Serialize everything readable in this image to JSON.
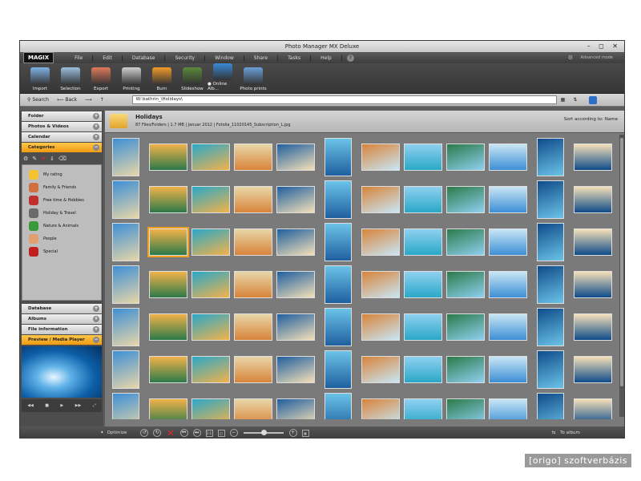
{
  "window": {
    "title": "Photo Manager MX Deluxe",
    "controls": "– ◻ ✕"
  },
  "menu": {
    "logo": "MAGIX",
    "items": [
      "File",
      "Edit",
      "Database",
      "Security",
      "Window",
      "Share",
      "Tasks",
      "Help"
    ],
    "advanced_mode": "Advanced mode"
  },
  "toolbar": {
    "buttons": [
      {
        "label": "Import",
        "color": "#7fb3e6"
      },
      {
        "label": "Selection",
        "color": "#9ac0e0"
      },
      {
        "label": "Export",
        "color": "#e07a5a"
      },
      {
        "label": "Printing",
        "color": "#cfcfcf"
      },
      {
        "label": "Burn",
        "color": "#f39a2a"
      },
      {
        "label": "Slideshow",
        "color": "#5a8a3a"
      },
      {
        "label": "● Online Alb...",
        "color": "#3a8ad8"
      },
      {
        "label": "Photo prints",
        "color": "#6aa0d8"
      }
    ]
  },
  "navbar": {
    "search": "Search",
    "back": "Back",
    "path": "W:\\kathrin_\\Holidays\\"
  },
  "left_panel": {
    "panels_top": [
      "Folder",
      "Photos & Videos",
      "Calendar",
      "Categories"
    ],
    "active_top": "Categories",
    "categories": [
      {
        "label": "My rating",
        "icon": "star-icon",
        "color": "#f2c230"
      },
      {
        "label": "Family & Friends",
        "icon": "family-icon",
        "color": "#d07040"
      },
      {
        "label": "Free time & Hobbies",
        "icon": "hobbies-icon",
        "color": "#c03030"
      },
      {
        "label": "Holiday & Travel",
        "icon": "car-icon",
        "color": "#6a6a6a"
      },
      {
        "label": "Nature & Animals",
        "icon": "parrot-icon",
        "color": "#3a9a3a"
      },
      {
        "label": "People",
        "icon": "person-icon",
        "color": "#e0a070"
      },
      {
        "label": "Special",
        "icon": "special-icon",
        "color": "#c02020"
      }
    ],
    "panels_bottom": [
      "Database",
      "Albums",
      "File information",
      "Preview / Media Player"
    ],
    "active_bottom": "Preview / Media Player"
  },
  "main": {
    "folder_name": "Holidays",
    "folder_info": "87 Files/Folders  |  1.7 MB  |  Januar 2012  |  Fotolia_11020145_Subscription_L.jpg",
    "sort_label": "Sort according to: Name"
  },
  "bottom": {
    "optimize": "Optimize",
    "to_album": "To album"
  },
  "watermark": "[origo] szoftverbázis",
  "thumb_palette": [
    "#3d8fd6",
    "#f2b24a",
    "#2aa8c8",
    "#e8d6a8",
    "#1f5f9f",
    "#6bc3e8",
    "#d8843a",
    "#8fd0f0",
    "#2c7a4a",
    "#c9e6f5",
    "#0f4c8a",
    "#f4e0b8"
  ]
}
